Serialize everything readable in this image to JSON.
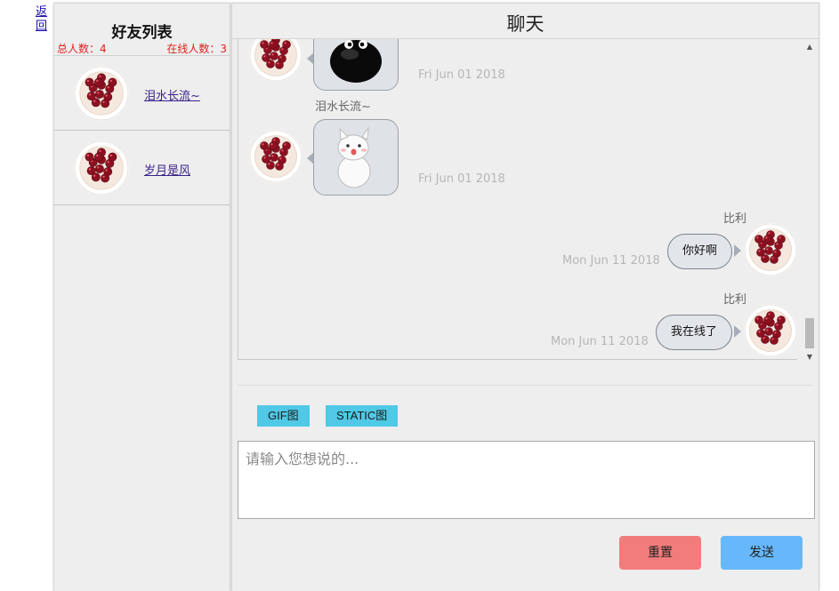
{
  "nav": {
    "back_label": "返回"
  },
  "friends": {
    "title": "好友列表",
    "total_count": "总人数：4",
    "online_count": "在线人数：3",
    "items": [
      {
        "name": "泪水长流~"
      },
      {
        "name": "岁月是风"
      }
    ]
  },
  "chat": {
    "title": "聊天",
    "messages": [
      {
        "side": "left",
        "type": "image",
        "sticker": "black-blob-sticker",
        "sender": "",
        "time": "Fri Jun 01 2018"
      },
      {
        "side": "left",
        "type": "image",
        "sticker": "white-cat-sticker",
        "sender": "泪水长流~",
        "time": "Fri Jun 01 2018"
      },
      {
        "side": "right",
        "type": "text",
        "text": "你好啊",
        "sender": "比利",
        "time": "Mon Jun 11 2018"
      },
      {
        "side": "right",
        "type": "text",
        "text": "我在线了",
        "sender": "比利",
        "time": "Mon Jun 11 2018"
      }
    ],
    "gif_button": "GIF图",
    "static_button": "STATIC图",
    "input_placeholder": "请输入您想说的...",
    "reset_button": "重置",
    "send_button": "发送"
  },
  "colors": {
    "count_red": "#e02020",
    "type_button": "#4fc9e6",
    "reset_button": "#f27c7c",
    "send_button": "#67b8fb"
  }
}
